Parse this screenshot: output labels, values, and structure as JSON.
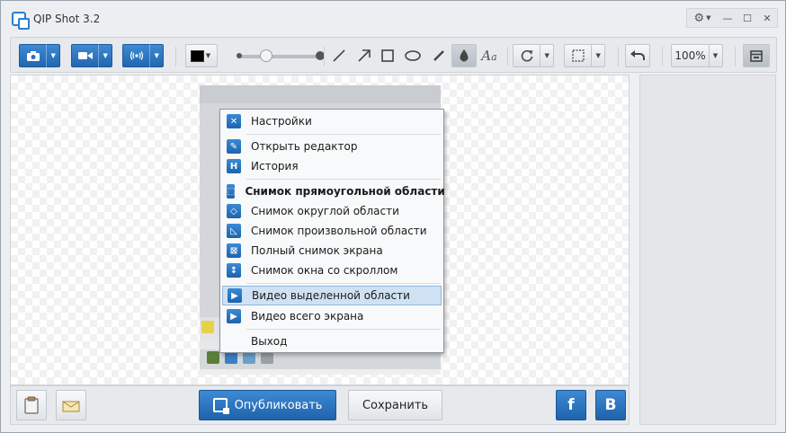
{
  "window": {
    "title": "QIP Shot 3.2"
  },
  "toolbar": {
    "zoom": "100%",
    "color": "#000000",
    "accent": "#2a74c0",
    "icons": [
      "camera-icon",
      "video-icon",
      "broadcast-icon",
      "line-icon",
      "arrow-icon",
      "rectangle-icon",
      "ellipse-icon",
      "pencil-icon",
      "blur-drop-icon",
      "text-icon",
      "rotate-icon",
      "crop-select-icon",
      "undo-icon",
      "calendar-icon"
    ]
  },
  "menu": {
    "items": [
      {
        "label": "Настройки",
        "icon": "settings-tools-icon"
      },
      {
        "label": "Открыть редактор",
        "icon": "editor-pencil-icon"
      },
      {
        "label": "История",
        "icon": "history-icon"
      },
      {
        "label": "Снимок прямоугольной области",
        "icon": "rect-capture-icon",
        "bold": true
      },
      {
        "label": "Снимок округлой области",
        "icon": "round-capture-icon"
      },
      {
        "label": "Снимок произвольной области",
        "icon": "freeform-capture-icon"
      },
      {
        "label": "Полный снимок экрана",
        "icon": "fullscreen-capture-icon"
      },
      {
        "label": "Снимок окна со скроллом",
        "icon": "scroll-capture-icon"
      },
      {
        "label": "Видео выделенной области",
        "icon": "video-area-icon",
        "highlighted": true
      },
      {
        "label": "Видео всего экрана",
        "icon": "video-screen-icon"
      },
      {
        "label": "Выход"
      }
    ]
  },
  "bottom": {
    "publish_label": "Опубликовать",
    "save_label": "Сохранить",
    "facebook_letter": "f",
    "vk_letter": "B"
  }
}
